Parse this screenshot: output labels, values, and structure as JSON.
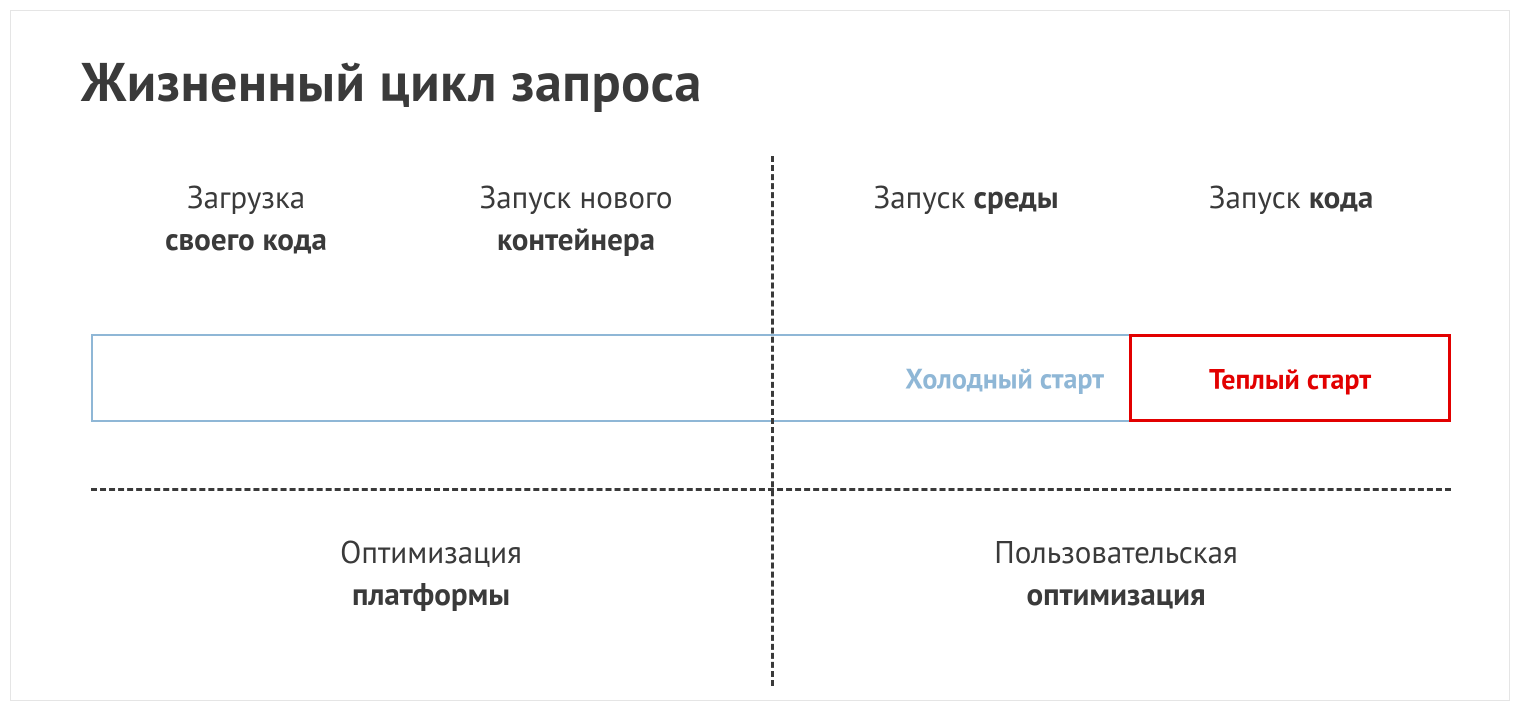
{
  "title": "Жизненный цикл запроса",
  "stages": {
    "load_code": {
      "line1": "Загрузка",
      "line2": "своего кода"
    },
    "new_container": {
      "line1": "Запуск нового",
      "line2": "контейнера"
    },
    "start_env": {
      "line1": "Запуск ",
      "line2": "среды"
    },
    "start_code": {
      "line1": "Запуск ",
      "line2": "кода"
    }
  },
  "bar": {
    "cold_label": "Холодный старт",
    "warm_label": "Теплый старт"
  },
  "optimization": {
    "platform": {
      "line1": "Оптимизация",
      "line2": "платформы"
    },
    "user": {
      "line1": "Пользовательская",
      "line2": "оптимизация"
    }
  },
  "colors": {
    "cold_border": "#8fb7d6",
    "warm_border": "#e20000",
    "text": "#3a3a3a"
  }
}
